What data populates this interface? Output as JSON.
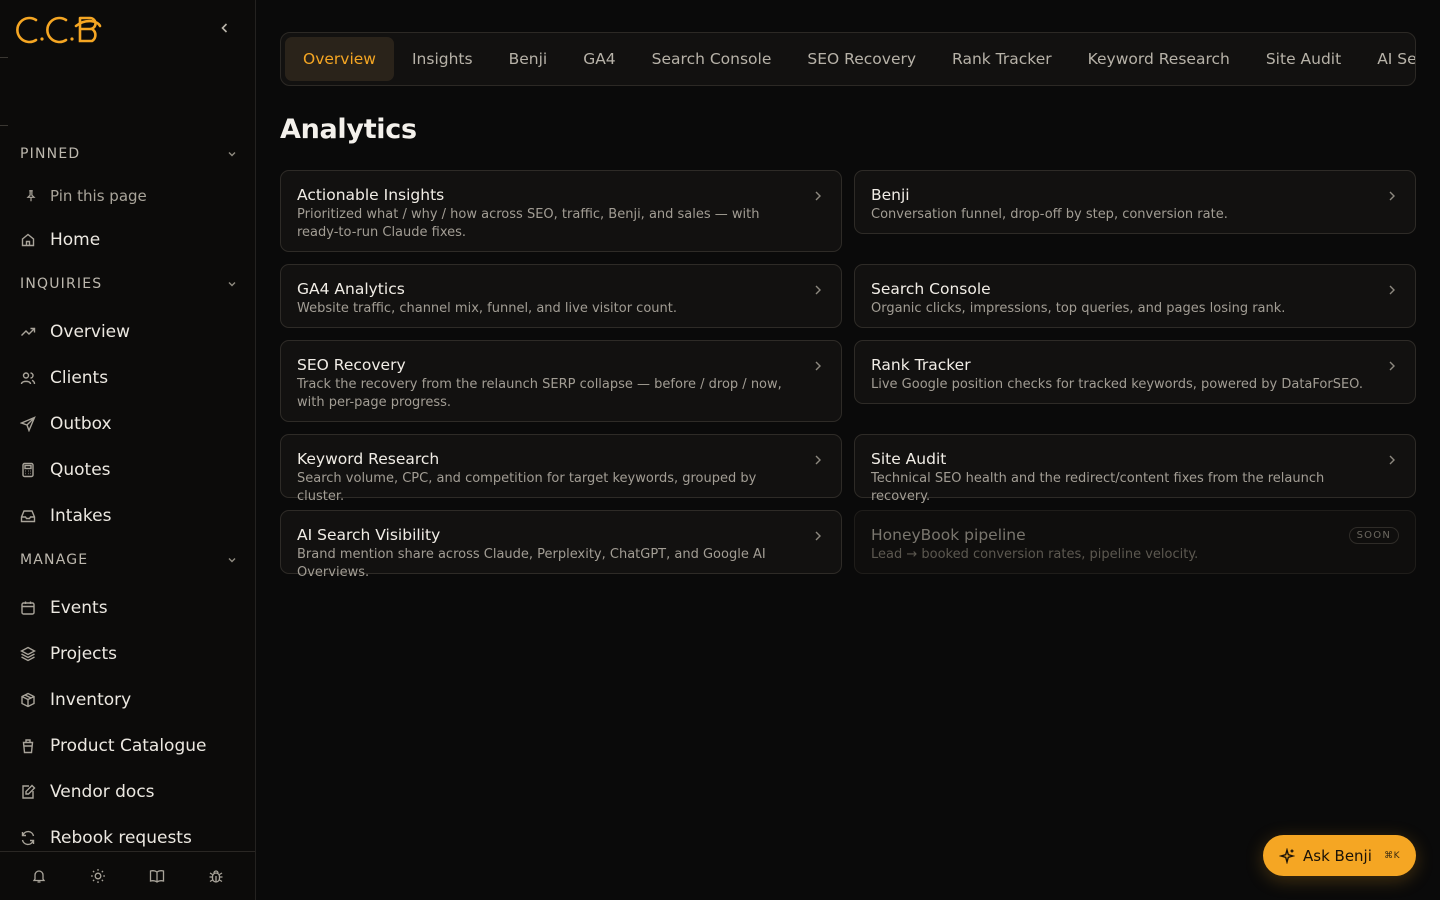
{
  "app": {
    "logo_text": "CCB",
    "accent": "#f5a623"
  },
  "sidebar": {
    "collapse_icon": "chevron-left-icon",
    "pinned": {
      "label": "PINNED",
      "pin_this_page": "Pin this page"
    },
    "home": "Home",
    "inquiries": {
      "label": "INQUIRIES",
      "items": [
        {
          "label": "Overview",
          "icon": "trend-icon"
        },
        {
          "label": "Clients",
          "icon": "users-icon"
        },
        {
          "label": "Outbox",
          "icon": "send-icon"
        },
        {
          "label": "Quotes",
          "icon": "calculator-icon"
        },
        {
          "label": "Intakes",
          "icon": "inbox-icon"
        }
      ]
    },
    "manage": {
      "label": "MANAGE",
      "items": [
        {
          "label": "Events",
          "icon": "calendar-icon"
        },
        {
          "label": "Projects",
          "icon": "layers-icon"
        },
        {
          "label": "Inventory",
          "icon": "box-icon"
        },
        {
          "label": "Product Catalogue",
          "icon": "cup-icon"
        },
        {
          "label": "Vendor docs",
          "icon": "edit-doc-icon"
        },
        {
          "label": "Rebook requests",
          "icon": "refresh-icon"
        }
      ]
    },
    "footer_icons": [
      "bell-icon",
      "sun-icon",
      "book-icon",
      "bug-icon"
    ]
  },
  "tabs": [
    "Overview",
    "Insights",
    "Benji",
    "GA4",
    "Search Console",
    "SEO Recovery",
    "Rank Tracker",
    "Keyword Research",
    "Site Audit",
    "AI Search Visibility"
  ],
  "active_tab": "Overview",
  "main": {
    "title": "Analytics",
    "cards": [
      {
        "title": "Actionable Insights",
        "desc": "Prioritized what / why / how across SEO, traffic, Benji, and sales — with ready-to-run Claude fixes."
      },
      {
        "title": "Benji",
        "desc": "Conversation funnel, drop-off by step, conversion rate."
      },
      {
        "title": "GA4 Analytics",
        "desc": "Website traffic, channel mix, funnel, and live visitor count."
      },
      {
        "title": "Search Console",
        "desc": "Organic clicks, impressions, top queries, and pages losing rank."
      },
      {
        "title": "SEO Recovery",
        "desc": "Track the recovery from the relaunch SERP collapse — before / drop / now, with per-page progress."
      },
      {
        "title": "Rank Tracker",
        "desc": "Live Google position checks for tracked keywords, powered by DataForSEO."
      },
      {
        "title": "Keyword Research",
        "desc": "Search volume, CPC, and competition for target keywords, grouped by cluster."
      },
      {
        "title": "Site Audit",
        "desc": "Technical SEO health and the redirect/content fixes from the relaunch recovery."
      },
      {
        "title": "AI Search Visibility",
        "desc": "Brand mention share across Claude, Perplexity, ChatGPT, and Google AI Overviews."
      },
      {
        "title": "HoneyBook pipeline",
        "desc": "Lead → booked conversion rates, pipeline velocity.",
        "badge": "SOON"
      }
    ]
  },
  "ask_benji": {
    "label": "Ask Benji",
    "shortcut": "⌘K"
  }
}
